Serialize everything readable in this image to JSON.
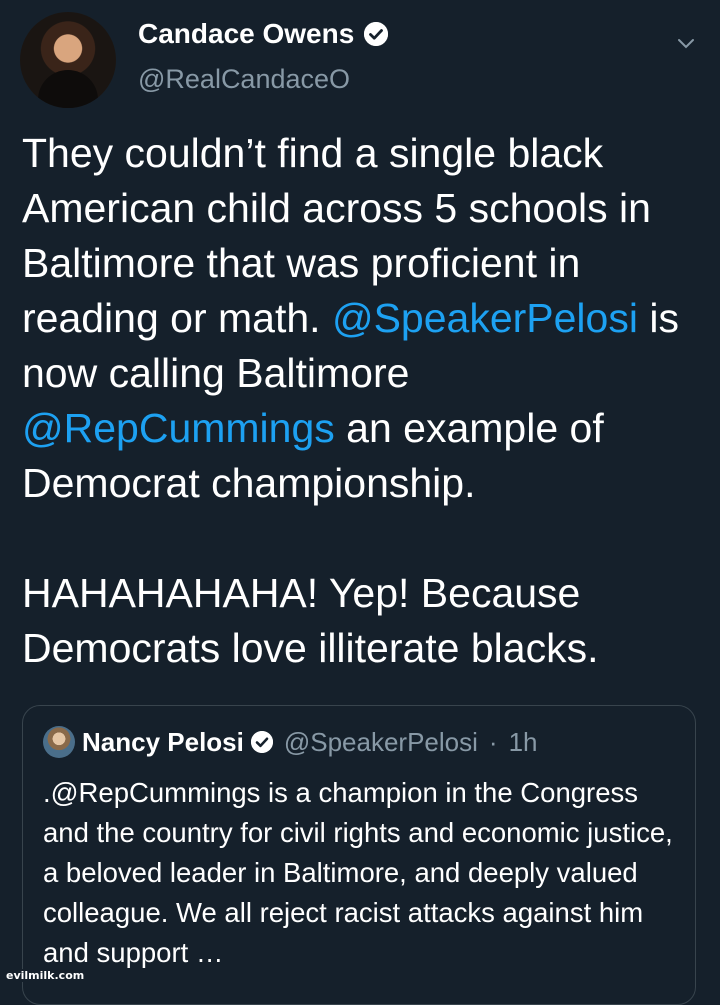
{
  "tweet": {
    "author_name": "Candace Owens",
    "author_handle": "@RealCandaceO",
    "text_parts": [
      "They couldn’t find a single black American child across 5 schools in Baltimore that was proficient in reading or math. ",
      "@SpeakerPelosi",
      " is now calling Baltimore ",
      "@RepCummings",
      " an example of Democrat championship."
    ],
    "text_para2": "HAHAHAHAHA! Yep! Because Democrats love illiterate blacks.",
    "icons": {
      "verified": "verified-badge-icon",
      "menu": "chevron-down-icon"
    }
  },
  "quoted_tweet": {
    "author_name": "Nancy Pelosi",
    "author_handle": "@SpeakerPelosi",
    "separator": "·",
    "time": "1h",
    "text": ".@RepCummings is a champion in the Congress and the country for civil rights and economic justice, a beloved leader in Baltimore, and deeply valued colleague. We all reject racist attacks against him and support …"
  },
  "watermark": "evilmilk.com",
  "colors": {
    "background": "#15202b",
    "mention": "#1da1f2",
    "secondary": "#8899a6",
    "border": "#38444d"
  }
}
